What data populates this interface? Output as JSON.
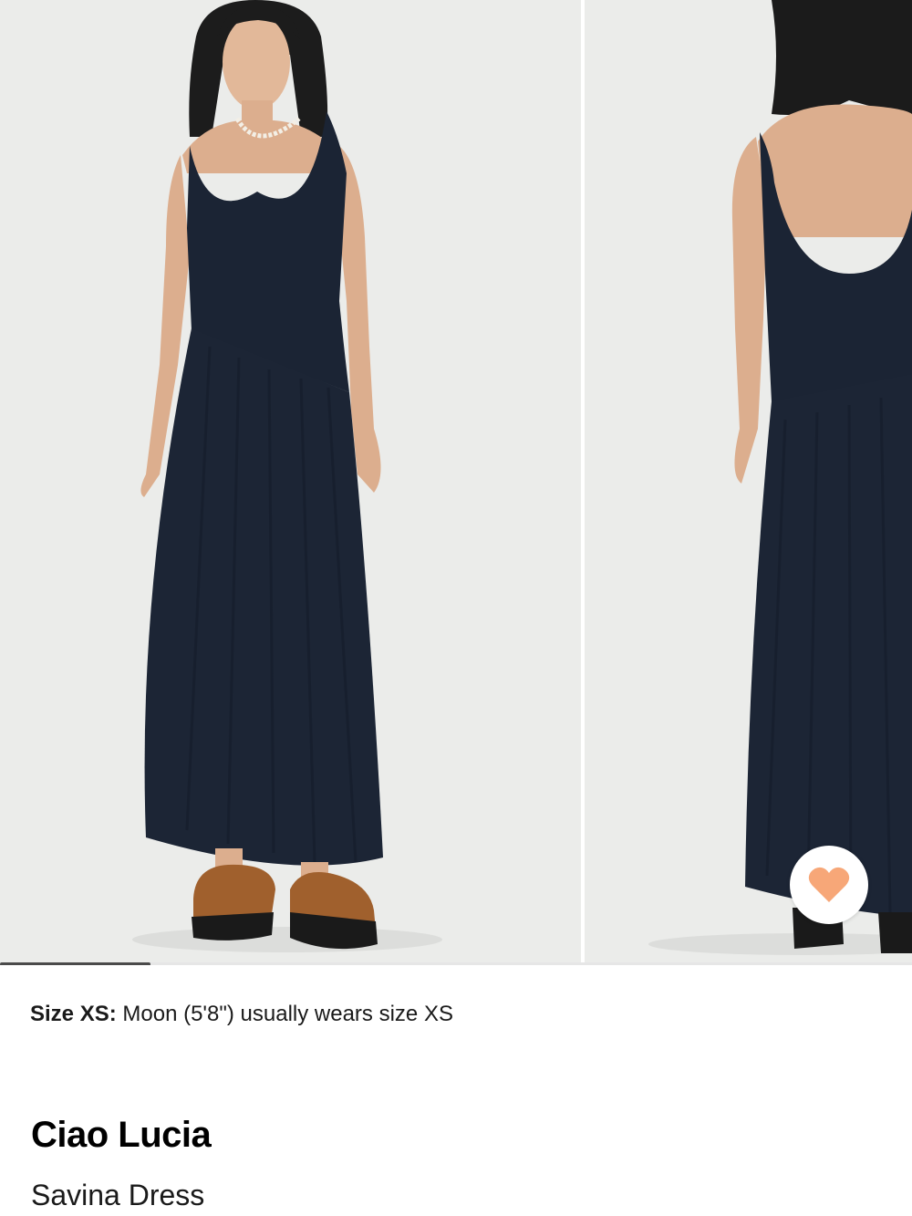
{
  "carousel": {
    "images": [
      {
        "alt": "front-view-photo"
      },
      {
        "alt": "back-view-photo"
      }
    ],
    "progress_fraction": 0.165,
    "progress_color": "#4a4a4a",
    "wishlist_icon": "heart-icon",
    "wishlist_color": "#f7a778"
  },
  "size_info": {
    "label": "Size XS:",
    "text": "Moon (5'8\") usually wears size XS"
  },
  "product": {
    "brand": "Ciao Lucia",
    "name": "Savina Dress"
  },
  "colors": {
    "dress": "#1b2434",
    "background": "#ebecea"
  }
}
